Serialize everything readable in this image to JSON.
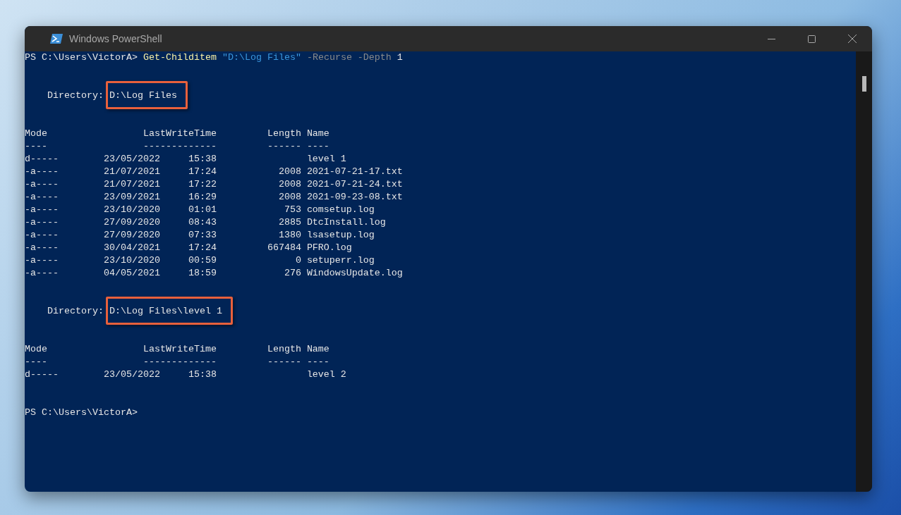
{
  "window": {
    "title": "Windows PowerShell"
  },
  "console": {
    "lines": [
      {
        "kind": "prompt",
        "prompt": "PS C:\\Users\\VictorA>",
        "command": "Get-Childitem",
        "argument": "\"D:\\Log Files\"",
        "parameters": "-Recurse -Depth",
        "value": "1"
      },
      {
        "kind": "blank"
      },
      {
        "kind": "blank"
      },
      {
        "kind": "directory",
        "label": "Directory:",
        "path": "D:\\Log Files",
        "highlighted": true
      },
      {
        "kind": "blank"
      },
      {
        "kind": "blank"
      },
      {
        "kind": "header",
        "columns": [
          "Mode",
          "LastWriteTime",
          "Length",
          "Name"
        ]
      },
      {
        "kind": "header",
        "columns": [
          "----",
          "-------------",
          "------",
          "----"
        ]
      },
      {
        "kind": "row",
        "mode": "d-----",
        "date": "23/05/2022",
        "time": "15:38",
        "name": "level 1"
      },
      {
        "kind": "row",
        "mode": "-a----",
        "date": "21/07/2021",
        "time": "17:24",
        "length": "2008",
        "name": "2021-07-21-17.txt"
      },
      {
        "kind": "row",
        "mode": "-a----",
        "date": "21/07/2021",
        "time": "17:22",
        "length": "2008",
        "name": "2021-07-21-24.txt"
      },
      {
        "kind": "row",
        "mode": "-a----",
        "date": "23/09/2021",
        "time": "16:29",
        "length": "2008",
        "name": "2021-09-23-08.txt"
      },
      {
        "kind": "row",
        "mode": "-a----",
        "date": "23/10/2020",
        "time": "01:01",
        "length": "753",
        "name": "comsetup.log"
      },
      {
        "kind": "row",
        "mode": "-a----",
        "date": "27/09/2020",
        "time": "08:43",
        "length": "2885",
        "name": "DtcInstall.log"
      },
      {
        "kind": "row",
        "mode": "-a----",
        "date": "27/09/2020",
        "time": "07:33",
        "length": "1380",
        "name": "lsasetup.log"
      },
      {
        "kind": "row",
        "mode": "-a----",
        "date": "30/04/2021",
        "time": "17:24",
        "length": "667484",
        "name": "PFRO.log"
      },
      {
        "kind": "row",
        "mode": "-a----",
        "date": "23/10/2020",
        "time": "00:59",
        "length": "0",
        "name": "setuperr.log"
      },
      {
        "kind": "row",
        "mode": "-a----",
        "date": "04/05/2021",
        "time": "18:59",
        "length": "276",
        "name": "WindowsUpdate.log"
      },
      {
        "kind": "blank"
      },
      {
        "kind": "blank"
      },
      {
        "kind": "directory",
        "label": "Directory:",
        "path": "D:\\Log Files\\level 1",
        "highlighted": true
      },
      {
        "kind": "blank"
      },
      {
        "kind": "blank"
      },
      {
        "kind": "header",
        "columns": [
          "Mode",
          "LastWriteTime",
          "Length",
          "Name"
        ]
      },
      {
        "kind": "header",
        "columns": [
          "----",
          "-------------",
          "------",
          "----"
        ]
      },
      {
        "kind": "row",
        "mode": "d-----",
        "date": "23/05/2022",
        "time": "15:38",
        "name": "level 2"
      },
      {
        "kind": "blank"
      },
      {
        "kind": "blank"
      },
      {
        "kind": "prompt",
        "prompt": "PS C:\\Users\\VictorA>"
      }
    ]
  }
}
